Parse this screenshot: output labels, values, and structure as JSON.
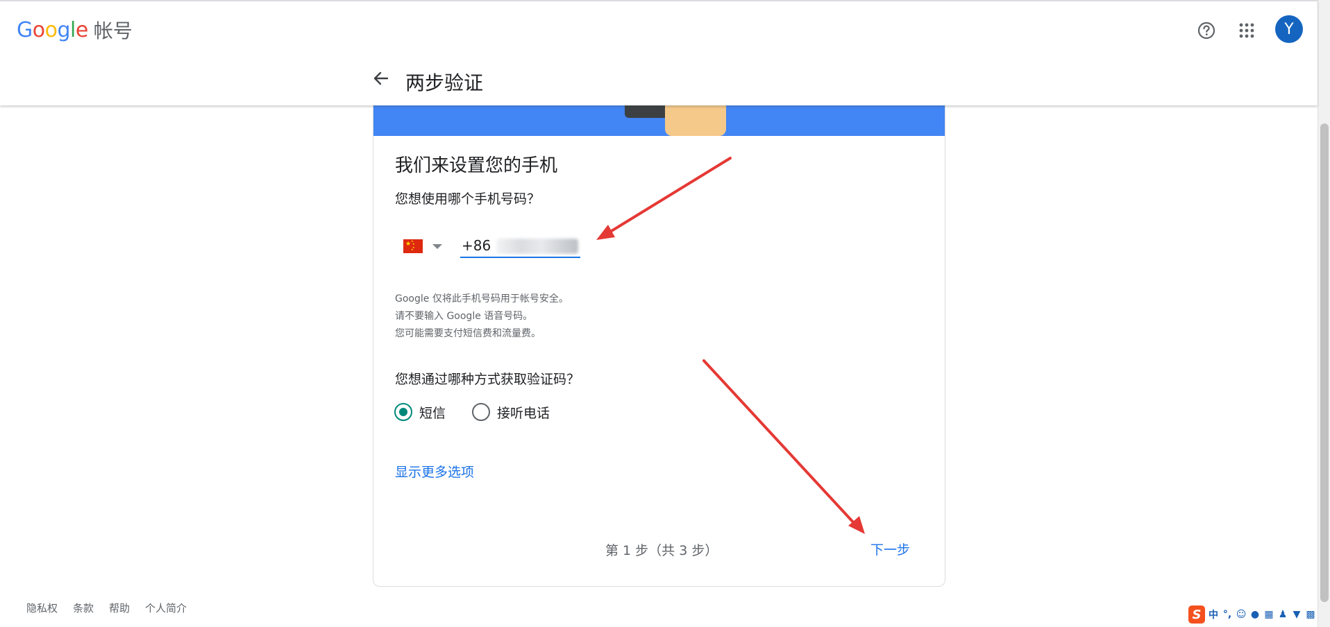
{
  "header": {
    "logo": {
      "G": "G",
      "o1": "o",
      "o2": "o",
      "g": "g",
      "l": "l",
      "e": "e"
    },
    "product_name": "帐号",
    "avatar_letter": "Y",
    "page_title": "两步验证"
  },
  "card": {
    "heading": "我们来设置您的手机",
    "phone_question": "您想使用哪个手机号码？",
    "country_code": "+86",
    "notes": [
      "Google 仅将此手机号码用于帐号安全。",
      "请不要输入 Google 语音号码。",
      "您可能需要支付短信费和流量费。"
    ],
    "method_question": "您想通过哪种方式获取验证码？",
    "methods": [
      {
        "label": "短信",
        "checked": true
      },
      {
        "label": "接听电话",
        "checked": false
      }
    ],
    "more_options": "显示更多选项",
    "step_indicator": "第 1 步（共 3 步）",
    "next_label": "下一步"
  },
  "footer": {
    "links": [
      "隐私权",
      "条款",
      "帮助",
      "个人简介"
    ]
  },
  "ime": {
    "logo": "S",
    "mode": "中"
  },
  "colors": {
    "banner": "#4285F4",
    "link": "#1a73e8",
    "radio_checked": "#00897b",
    "avatar": "#1565c0",
    "annotation_arrow": "#e53935"
  },
  "icons": [
    "help-icon",
    "apps-icon",
    "back-arrow-icon",
    "china-flag-icon",
    "dropdown-caret-icon"
  ]
}
